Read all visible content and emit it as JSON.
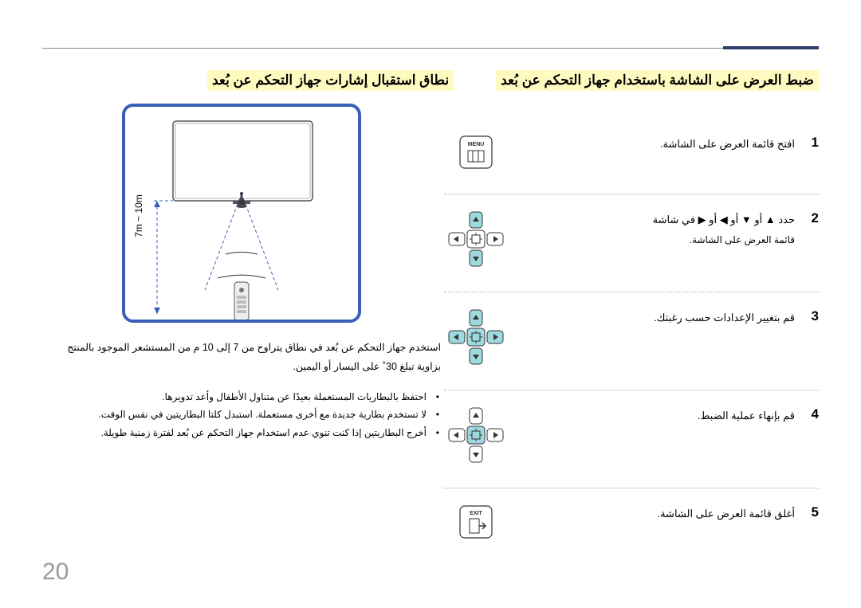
{
  "page_number": "20",
  "right_title": "ضبط العرض على الشاشة باستخدام جهاز التحكم عن بُعد",
  "left_title": "نطاق استقبال إشارات جهاز التحكم عن بُعد",
  "steps": [
    {
      "num": "1",
      "text": "افتح قائمة العرض على الشاشة.",
      "sub": ""
    },
    {
      "num": "2",
      "text": "حدد ▲ أو ▼ أو ◀ أو ▶ في شاشة",
      "sub": "قائمة العرض على الشاشة."
    },
    {
      "num": "3",
      "text": "قم بتغيير الإعدادات حسب رغبتك.",
      "sub": ""
    },
    {
      "num": "4",
      "text": "قم بإنهاء عملية الضبط.",
      "sub": ""
    },
    {
      "num": "5",
      "text": "أغلق قائمة العرض على الشاشة.",
      "sub": ""
    }
  ],
  "distance": "7m ~ 10m",
  "left_para": "استخدم جهاز التحكم عن بُعد في نطاق يتراوح من 7 إلى 10 م من المستشعر الموجود بالمنتج بزاوية تبلغ 30˚ على اليسار أو اليمين.",
  "bullets": [
    "احتفظ بالبطاريات المستعملة بعيدًا عن متناول الأطفال وأعد تدويرها.",
    "لا تستخدم بطارية جديدة مع أخرى مستعملة. استبدل كلتا البطاريتين في نفس الوقت.",
    "أخرج البطاريتين إذا كنت تنوي عدم استخدام جهاز التحكم عن بُعد لفترة زمنية طويلة."
  ],
  "icon_labels": {
    "menu": "MENU",
    "exit": "EXIT"
  }
}
